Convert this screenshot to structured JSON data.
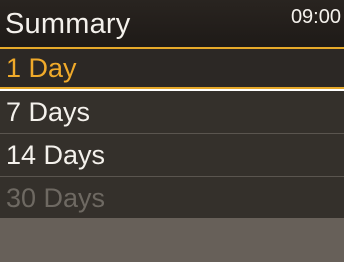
{
  "header": {
    "title": "Summary",
    "time": "09:00"
  },
  "menu": {
    "items": [
      {
        "label": "1 Day",
        "state": "selected"
      },
      {
        "label": "7 Days",
        "state": "enabled"
      },
      {
        "label": "14 Days",
        "state": "enabled"
      },
      {
        "label": "30 Days",
        "state": "disabled"
      }
    ]
  },
  "colors": {
    "accent": "#e6a92a",
    "text": "#f4f1ec",
    "disabled_text": "#6e6962",
    "row_background": "#34302b",
    "footer_background": "#676059"
  }
}
